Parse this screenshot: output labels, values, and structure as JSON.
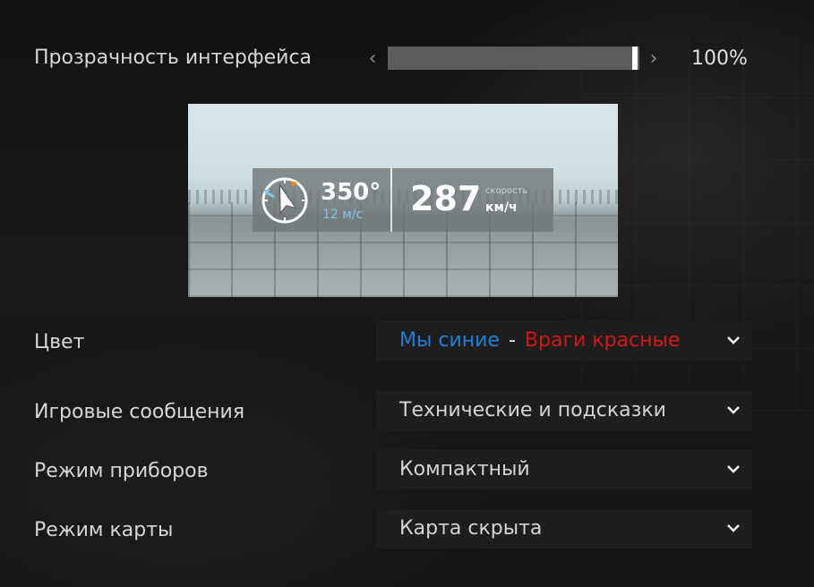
{
  "transparency": {
    "label": "Прозрачность интерфейса",
    "value_percent": 100,
    "value_text": "100%",
    "left_arrow": "‹",
    "right_arrow": "›"
  },
  "preview": {
    "heading": "350°",
    "wind": "12 м/с",
    "speed": "287",
    "speed_caption": "скорость",
    "speed_unit": "км/ч",
    "wind_color": "#7fc6ee"
  },
  "color": {
    "label": "Цвет",
    "value_us": "Мы синие",
    "separator": "-",
    "value_enemies": "Враги красные",
    "us_color": "#1e7fd8",
    "enemies_color": "#d21515"
  },
  "messages": {
    "label": "Игровые сообщения",
    "value": "Технические и подсказки"
  },
  "instruments": {
    "label": "Режим приборов",
    "value": "Компактный"
  },
  "map": {
    "label": "Режим карты",
    "value": "Карта скрыта"
  },
  "icons": {
    "chevron": "chevron-down-icon",
    "compass": "compass-icon"
  }
}
